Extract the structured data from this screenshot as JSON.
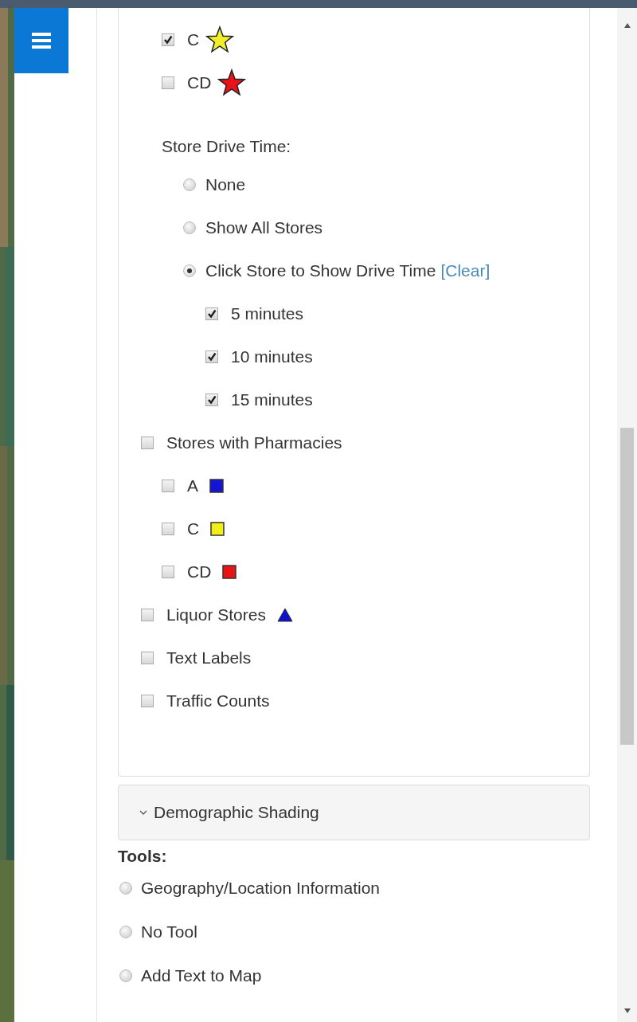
{
  "layers": [
    {
      "kind": "group",
      "children": [
        {
          "kind": "checkbox",
          "label": "C",
          "checked": true,
          "marker": {
            "kind": "star",
            "color": "#f2ee2c"
          }
        },
        {
          "kind": "checkbox",
          "label": "CD",
          "checked": false,
          "marker": {
            "kind": "star",
            "color": "#e8141a"
          }
        },
        {
          "kind": "heading",
          "label": "Store Drive Time:",
          "children": [
            {
              "kind": "radio",
              "label": "None",
              "selected": false
            },
            {
              "kind": "radio",
              "label": "Show All Stores",
              "selected": false
            },
            {
              "kind": "radio",
              "label": "Click Store to Show Drive Time",
              "link": "[Clear]",
              "selected": true,
              "children": [
                {
                  "kind": "checkbox",
                  "label": "5 minutes",
                  "checked": true
                },
                {
                  "kind": "checkbox",
                  "label": "10 minutes",
                  "checked": true
                },
                {
                  "kind": "checkbox",
                  "label": "15 minutes",
                  "checked": true
                }
              ]
            }
          ]
        }
      ]
    },
    {
      "kind": "checkbox",
      "label": "Stores with Pharmacies",
      "checked": false,
      "children": [
        {
          "kind": "checkbox",
          "label": "A",
          "checked": false,
          "marker": {
            "kind": "square",
            "color": "#1414d8"
          }
        },
        {
          "kind": "checkbox",
          "label": "C",
          "checked": false,
          "marker": {
            "kind": "square",
            "color": "#f0f018"
          }
        },
        {
          "kind": "checkbox",
          "label": "CD",
          "checked": false,
          "marker": {
            "kind": "square",
            "color": "#e81414"
          }
        }
      ]
    },
    {
      "kind": "checkbox",
      "label": "Liquor Stores",
      "checked": false,
      "marker": {
        "kind": "triangle",
        "color": "#1010c8"
      }
    },
    {
      "kind": "checkbox",
      "label": "Text Labels",
      "checked": false
    },
    {
      "kind": "checkbox",
      "label": "Traffic Counts",
      "checked": false
    }
  ],
  "accordion": {
    "label": "Demographic Shading",
    "expanded": false
  },
  "tools": {
    "title": "Tools:",
    "options": [
      {
        "label": "Geography/Location Information",
        "selected": false
      },
      {
        "label": "No Tool",
        "selected": false
      },
      {
        "label": "Add Text to Map",
        "selected": false
      }
    ]
  }
}
